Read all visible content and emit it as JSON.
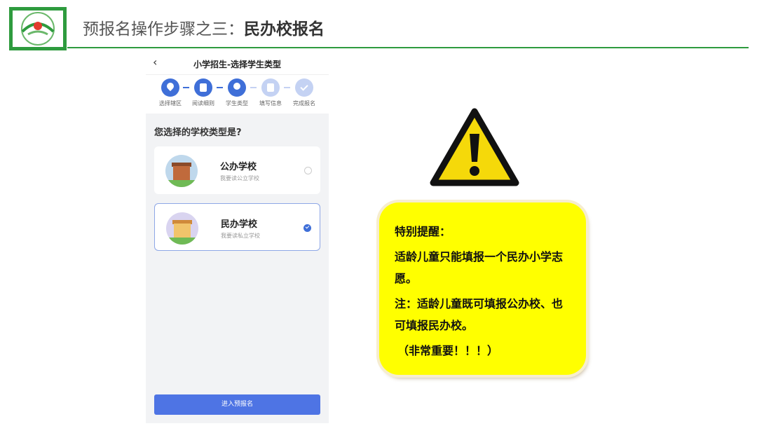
{
  "slide": {
    "title_prefix": "预报名操作步骤之三：",
    "title_emphasis": "民办校报名"
  },
  "phone": {
    "header_title": "小学招生-选择学生类型",
    "back_icon": "chevron-left-icon",
    "steps": [
      {
        "label": "选择辖区",
        "state": "done",
        "icon": "location-pin-icon"
      },
      {
        "label": "阅读细则",
        "state": "done",
        "icon": "document-icon"
      },
      {
        "label": "学生类型",
        "state": "current",
        "icon": "person-icon"
      },
      {
        "label": "填写信息",
        "state": "todo",
        "icon": "form-icon"
      },
      {
        "label": "完成报名",
        "state": "todo",
        "icon": "check-icon"
      }
    ],
    "question": "您选择的学校类型是?",
    "options": [
      {
        "name": "公办学校",
        "desc": "我要读公立学校",
        "selected": false
      },
      {
        "name": "民办学校",
        "desc": "我要读私立学校",
        "selected": true
      }
    ],
    "submit_label": "进入预报名"
  },
  "notice": {
    "heading": "特别提醒：",
    "line1": "适龄儿童只能填报一个民办小学志愿。",
    "line2": "注：适龄儿童既可填报公办校、也可填报民办校。",
    "line3": "（非常重要！！！）"
  },
  "colors": {
    "brand_green": "#2e9b3e",
    "primary_blue": "#4e74e4",
    "notice_yellow": "#ffff00",
    "warning_yellow": "#f5d90a"
  }
}
